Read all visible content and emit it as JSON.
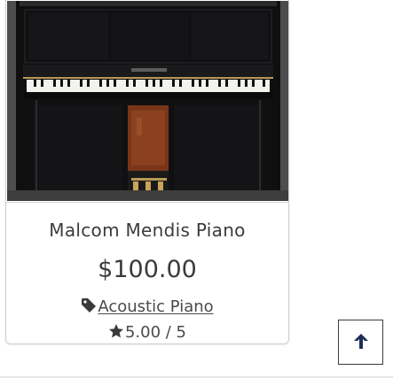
{
  "product": {
    "title": "Malcom Mendis Piano",
    "price": "$100.00",
    "category": "Acoustic Piano",
    "rating": "5.00 / 5",
    "image_icon": "upright-piano-photo"
  },
  "icons": {
    "category": "tag-icon",
    "rating": "star-icon",
    "scroll_top": "arrow-up-icon"
  },
  "colors": {
    "text": "#3b3b3b",
    "border": "#cfcfcf"
  }
}
